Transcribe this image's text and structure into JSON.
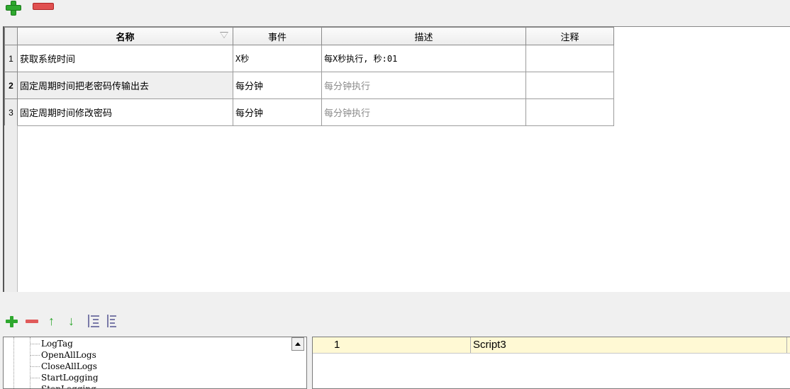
{
  "toolbar_top": {
    "add_icon": "plus-icon",
    "remove_icon": "minus-icon"
  },
  "grid": {
    "columns": [
      "名称",
      "事件",
      "描述",
      "注释"
    ],
    "rows": [
      {
        "num": "1",
        "name": "获取系统时间",
        "event": "X秒",
        "desc": "每X秒执行, 秒:01",
        "note": "",
        "desc_gray": false,
        "selected": false
      },
      {
        "num": "2",
        "name": "固定周期时间把老密码传输出去",
        "event": "每分钟",
        "desc": "每分钟执行",
        "note": "",
        "desc_gray": true,
        "selected": true
      },
      {
        "num": "3",
        "name": "固定周期时间修改密码",
        "event": "每分钟",
        "desc": "每分钟执行",
        "note": "",
        "desc_gray": true,
        "selected": false
      }
    ]
  },
  "toolbar_bottom": {
    "icons": [
      "plus-icon",
      "minus-icon",
      "arrow-up-icon",
      "arrow-down-icon",
      "indent-icon",
      "outdent-icon"
    ]
  },
  "tree": {
    "items": [
      "LogTag",
      "OpenAllLogs",
      "CloseAllLogs",
      "StartLogging",
      "StopLogging"
    ]
  },
  "script_list": {
    "rows": [
      {
        "num": "1",
        "name": "Script3"
      }
    ]
  },
  "colors": {
    "accent_green": "#2fa82f",
    "accent_red": "#e05050",
    "selected_row": "#fff9d4"
  }
}
